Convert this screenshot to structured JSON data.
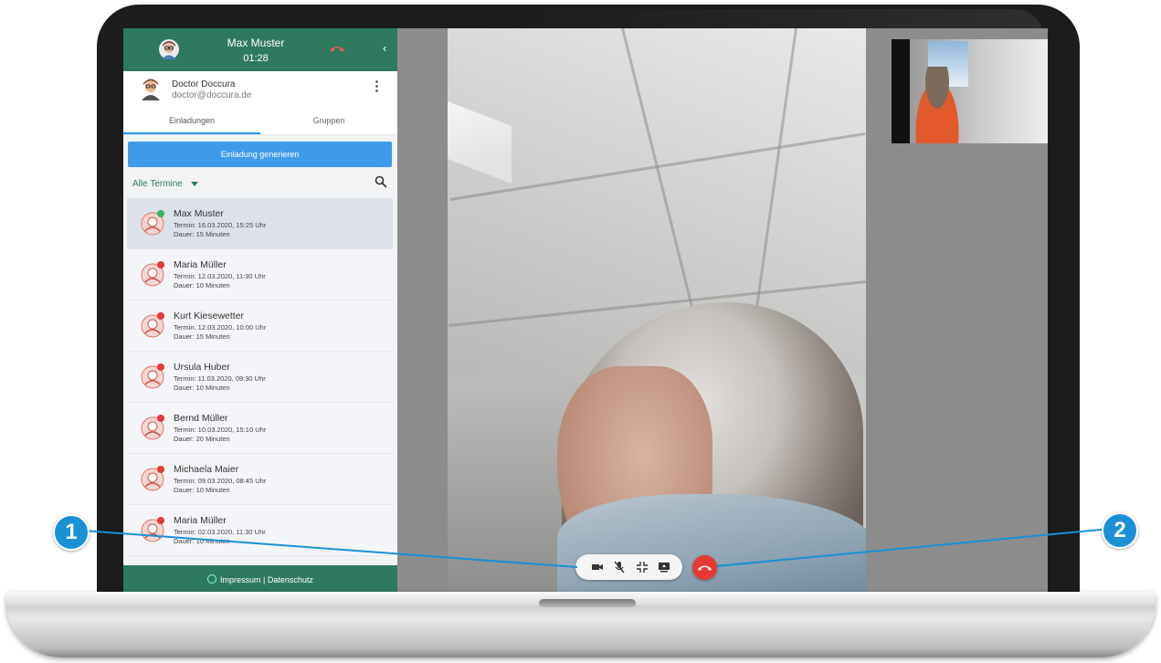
{
  "call": {
    "name": "Max Muster",
    "time": "01:28"
  },
  "user": {
    "name": "Doctor Doccura",
    "email": "doctor@doccura.de"
  },
  "tabs": [
    {
      "label": "Einladungen"
    },
    {
      "label": "Gruppen"
    }
  ],
  "generate_label": "Einladung generieren",
  "filter": {
    "label": "Alle Termine"
  },
  "appointments": [
    {
      "name": "Max Muster",
      "termin": "Termin: 16.03.2020, 15:25 Uhr",
      "dauer": "Dauer: 15 Minuten",
      "status": "online",
      "status_color": "#3cb35a"
    },
    {
      "name": "Maria Müller",
      "termin": "Termin: 12.03.2020, 11:30 Uhr",
      "dauer": "Dauer: 10 Minuten",
      "status": "offline",
      "status_color": "#e53935"
    },
    {
      "name": "Kurt Kiesewetter",
      "termin": "Termin: 12.03.2020, 10:00 Uhr",
      "dauer": "Dauer: 15 Minuten",
      "status": "offline",
      "status_color": "#e53935"
    },
    {
      "name": "Ursula Huber",
      "termin": "Termin: 11.03.2020, 09:30 Uhr",
      "dauer": "Dauer: 10 Minuten",
      "status": "offline",
      "status_color": "#e53935"
    },
    {
      "name": "Bernd Müller",
      "termin": "Termin: 10.03.2020, 15:10 Uhr",
      "dauer": "Dauer: 20 Minuten",
      "status": "offline",
      "status_color": "#e53935"
    },
    {
      "name": "Michaela Maier",
      "termin": "Termin: 09.03.2020, 08:45 Uhr",
      "dauer": "Dauer: 10 Minuten",
      "status": "offline",
      "status_color": "#e53935"
    },
    {
      "name": "Maria Müller",
      "termin": "Termin: 02.03.2020, 11:30 Uhr",
      "dauer": "Dauer: 10 Minuten",
      "status": "offline",
      "status_color": "#e53935"
    }
  ],
  "footer": {
    "text": "Impressum | Datenschutz"
  },
  "controls": [
    {
      "icon": "camera-icon"
    },
    {
      "icon": "mic-off-icon"
    },
    {
      "icon": "exit-fullscreen-icon"
    },
    {
      "icon": "screen-share-icon"
    }
  ],
  "hangup_icon": "hangup-icon",
  "callouts": [
    {
      "label": "1"
    },
    {
      "label": "2"
    }
  ],
  "colors": {
    "brand_green": "#2d7a5f",
    "button_blue": "#3d9be9",
    "hangup_red": "#e53935",
    "callout_blue": "#1a90d6"
  }
}
